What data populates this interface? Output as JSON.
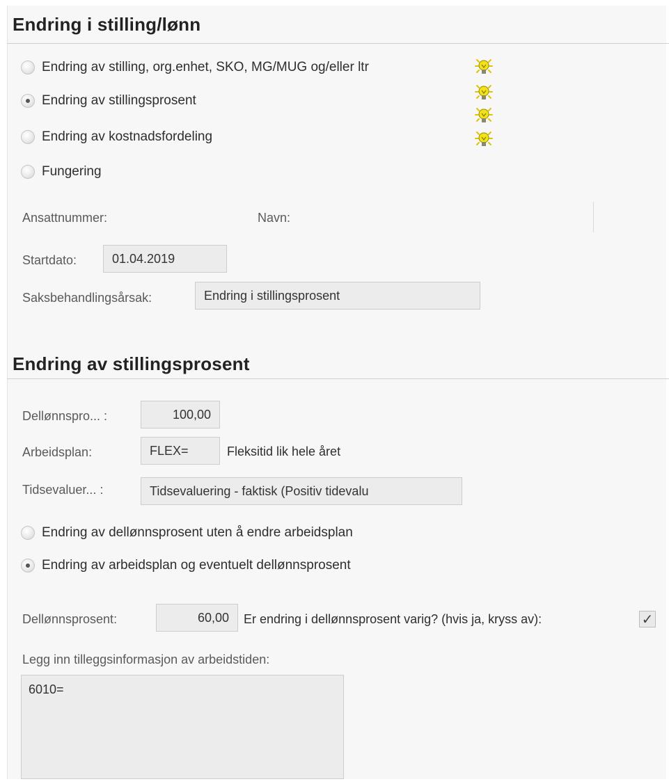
{
  "section1": {
    "title": "Endring i stilling/lønn",
    "options": [
      {
        "label": "Endring av stilling, org.enhet, SKO, MG/MUG og/eller ltr",
        "checked": false,
        "icon": "lightbulb-icon"
      },
      {
        "label": "Endring av stillingsprosent",
        "checked": true,
        "icon": "lightbulb-icon"
      },
      {
        "label": "Endring av kostnadsfordeling",
        "checked": false,
        "icon": "lightbulb-icon"
      },
      {
        "label": "Fungering",
        "checked": false,
        "icon": "lightbulb-icon"
      }
    ],
    "ansattnummer_label": "Ansattnummer:",
    "navn_label": "Navn:",
    "startdato_label": "Startdato:",
    "startdato_value": "01.04.2019",
    "aarsak_label": "Saksbehandlingsårsak:",
    "aarsak_value": "Endring i stillingsprosent"
  },
  "section2": {
    "title": "Endring av stillingsprosent",
    "dellonn_short_label": "Dellønnspro... :",
    "dellonn_short_value": "100,00",
    "arbeidsplan_label": "Arbeidsplan:",
    "arbeidsplan_value": "FLEX=",
    "arbeidsplan_desc": "Fleksitid lik hele året",
    "tidsevaluer_label": "Tidsevaluer... :",
    "tidsevaluer_value": "Tidsevaluering - faktisk (Positiv tidevalu",
    "options": [
      {
        "label": "Endring av dellønnsprosent uten å endre arbeidsplan",
        "checked": false
      },
      {
        "label": "Endring av arbeidsplan og eventuelt dellønnsprosent",
        "checked": true
      }
    ],
    "dellonnsprosent_label": "Dellønnsprosent:",
    "dellonnsprosent_value": "60,00",
    "varig_question": "Er endring i dellønnsprosent varig? (hvis ja, kryss av):",
    "varig_checked": true,
    "tillegg_label": "Legg inn tilleggsinformasjon av arbeidstiden:",
    "tillegg_value": "6010="
  },
  "colors": {
    "panel_bg": "#f7f7f7",
    "field_bg": "#ececec",
    "bulb_yellow": "#f2e21a"
  }
}
